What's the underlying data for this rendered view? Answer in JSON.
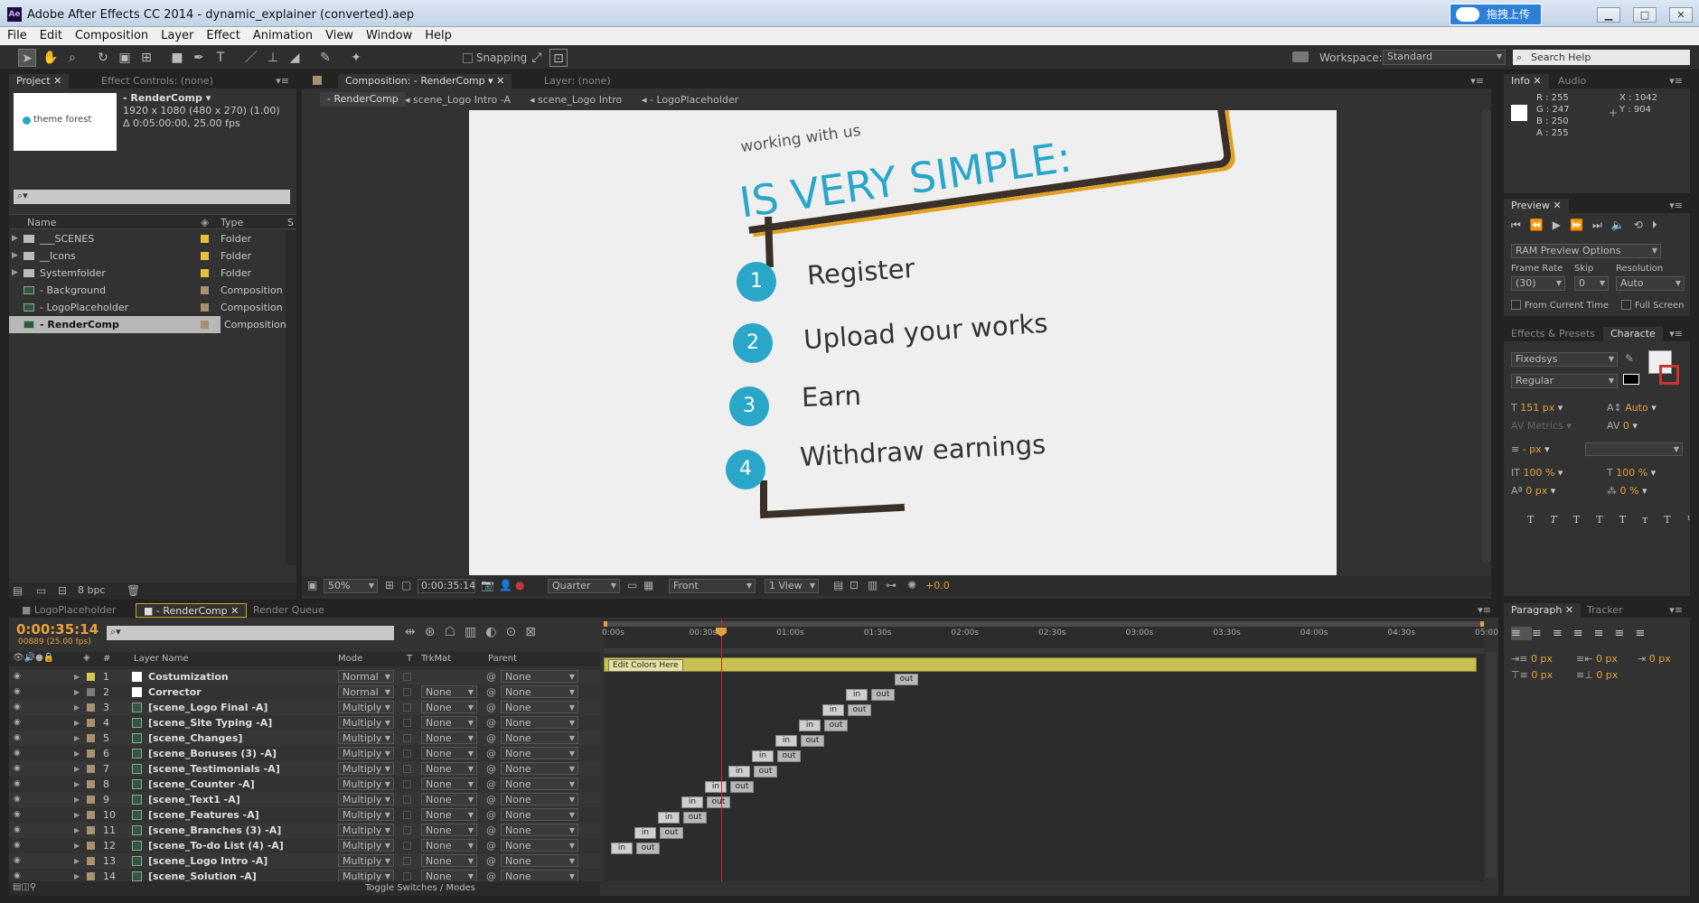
{
  "window": {
    "title": "Adobe After Effects CC 2014 - dynamic_explainer (converted).aep",
    "upload_label": "拖拽上传",
    "min": "▁",
    "max": "□",
    "close": "✕"
  },
  "menu": [
    "File",
    "Edit",
    "Composition",
    "Layer",
    "Effect",
    "Animation",
    "View",
    "Window",
    "Help"
  ],
  "toolbar": {
    "snapping": "Snapping",
    "workspace_label": "Workspace:",
    "workspace": "Standard",
    "search": "Search Help"
  },
  "project": {
    "tab_project": "Project",
    "tab_effects": "Effect Controls: (none)",
    "comp_name": "- RenderComp ▾",
    "comp_info1": "1920 x 1080  (480 x 270) (1.00)",
    "comp_info2": "Δ 0:05:00:00, 25.00 fps",
    "thumb_text": "theme forest",
    "col_name": "Name",
    "col_type": "Type",
    "col_s": "S",
    "items": [
      {
        "name": "___SCENES",
        "type": "Folder",
        "icon": "folder-icon"
      },
      {
        "name": "__Icons",
        "type": "Folder",
        "icon": "folder-icon"
      },
      {
        "name": "Systemfolder",
        "type": "Folder",
        "icon": "folder-icon"
      },
      {
        "name": "- Background",
        "type": "Composition",
        "icon": "composition-icon"
      },
      {
        "name": "- LogoPlaceholder",
        "type": "Composition",
        "icon": "composition-icon"
      },
      {
        "name": "- RenderComp",
        "type": "Composition",
        "icon": "composition-icon"
      }
    ],
    "bpc": "8 bpc"
  },
  "comp": {
    "tab_comp": "Composition: - RenderComp",
    "tab_layer": "Layer: (none)",
    "breadcrumbs": [
      "- RenderComp",
      "scene_Logo Intro -A",
      "scene_Logo Intro",
      "- LogoPlaceholder"
    ],
    "heading_small": "working with us",
    "heading_big": "IS VERY SIMPLE:",
    "steps": [
      {
        "n": "1",
        "text": "Register"
      },
      {
        "n": "2",
        "text": "Upload your works"
      },
      {
        "n": "3",
        "text": "Earn"
      },
      {
        "n": "4",
        "text": "Withdraw earnings"
      }
    ],
    "zoom": "50%",
    "timecode": "0:00:35:14",
    "resolution": "Quarter",
    "view": "Front",
    "views": "1 View",
    "exposure": "+0.0"
  },
  "info": {
    "tab_info": "Info",
    "tab_audio": "Audio",
    "r": "R : 255",
    "g": "G : 247",
    "b": "B : 250",
    "a": "A : 255",
    "x": "X : 1042",
    "y": "Y : 904"
  },
  "preview": {
    "tab": "Preview",
    "ram": "RAM Preview Options",
    "frame_rate_label": "Frame Rate",
    "skip_label": "Skip",
    "resolution_label": "Resolution",
    "frame_rate": "(30)",
    "skip": "0",
    "resolution": "Auto",
    "from_current": "From Current Time",
    "full_screen": "Full Screen"
  },
  "character": {
    "tab_effects": "Effects & Presets",
    "tab_char": "Characte",
    "font": "Fixedsys",
    "style": "Regular",
    "size": "151 px",
    "leading": "Auto",
    "kerning": "Metrics",
    "tracking": "0",
    "stroke": "- px",
    "vscale": "100 %",
    "hscale": "100 %",
    "baseline": "0 px",
    "tsume": "0 %",
    "styles": [
      "T",
      "T",
      "TT",
      "Tт",
      "T¹",
      "T₁"
    ]
  },
  "paragraph": {
    "tab": "Paragraph",
    "tab2": "Tracker",
    "vals": [
      "0 px",
      "0 px",
      "0 px",
      "0 px",
      "0 px"
    ]
  },
  "timeline": {
    "tab1": "LogoPlaceholder",
    "tab2": "- RenderComp",
    "tab3": "Render Queue",
    "timecode": "0:00:35:14",
    "frames": "00889 (25.00 fps)",
    "col_num": "#",
    "col_name": "Layer Name",
    "col_mode": "Mode",
    "col_t": "T",
    "col_trk": "TrkMat",
    "col_parent": "Parent",
    "ticks": [
      "0:00s",
      "00:30s",
      "01:00s",
      "01:30s",
      "02:00s",
      "02:30s",
      "03:00s",
      "03:30s",
      "04:00s",
      "04:30s",
      "05:00"
    ],
    "edit_colors": "Edit Colors Here",
    "toggle": "Toggle Switches / Modes",
    "layers": [
      {
        "n": "1",
        "name": "Costumization",
        "mode": "Normal",
        "trk": "",
        "parent": "None",
        "color": "#d4c84a"
      },
      {
        "n": "2",
        "name": "Corrector",
        "mode": "Normal",
        "trk": "None",
        "parent": "None",
        "color": "#7a7a7a"
      },
      {
        "n": "3",
        "name": "[scene_Logo Final -A]",
        "mode": "Multiply",
        "trk": "None",
        "parent": "None",
        "color": "#a89070"
      },
      {
        "n": "4",
        "name": "[scene_Site Typing -A]",
        "mode": "Multiply",
        "trk": "None",
        "parent": "None",
        "color": "#a89070"
      },
      {
        "n": "5",
        "name": "[scene_Changes]",
        "mode": "Multiply",
        "trk": "None",
        "parent": "None",
        "color": "#a89070"
      },
      {
        "n": "6",
        "name": "[scene_Bonuses (3) -A]",
        "mode": "Multiply",
        "trk": "None",
        "parent": "None",
        "color": "#a89070"
      },
      {
        "n": "7",
        "name": "[scene_Testimonials -A]",
        "mode": "Multiply",
        "trk": "None",
        "parent": "None",
        "color": "#a89070"
      },
      {
        "n": "8",
        "name": "[scene_Counter -A]",
        "mode": "Multiply",
        "trk": "None",
        "parent": "None",
        "color": "#a89070"
      },
      {
        "n": "9",
        "name": "[scene_Text1 -A]",
        "mode": "Multiply",
        "trk": "None",
        "parent": "None",
        "color": "#a89070"
      },
      {
        "n": "10",
        "name": "[scene_Features -A]",
        "mode": "Multiply",
        "trk": "None",
        "parent": "None",
        "color": "#a89070"
      },
      {
        "n": "11",
        "name": "[scene_Branches (3) -A]",
        "mode": "Multiply",
        "trk": "None",
        "parent": "None",
        "color": "#a89070"
      },
      {
        "n": "12",
        "name": "[scene_To-do List (4) -A]",
        "mode": "Multiply",
        "trk": "None",
        "parent": "None",
        "color": "#a89070"
      },
      {
        "n": "13",
        "name": "[scene_Logo Intro -A]",
        "mode": "Multiply",
        "trk": "None",
        "parent": "None",
        "color": "#a89070"
      },
      {
        "n": "14",
        "name": "[scene_Solution -A]",
        "mode": "Multiply",
        "trk": "None",
        "parent": "None",
        "color": "#a89070"
      }
    ],
    "marker_in": "in",
    "marker_out": "out"
  }
}
